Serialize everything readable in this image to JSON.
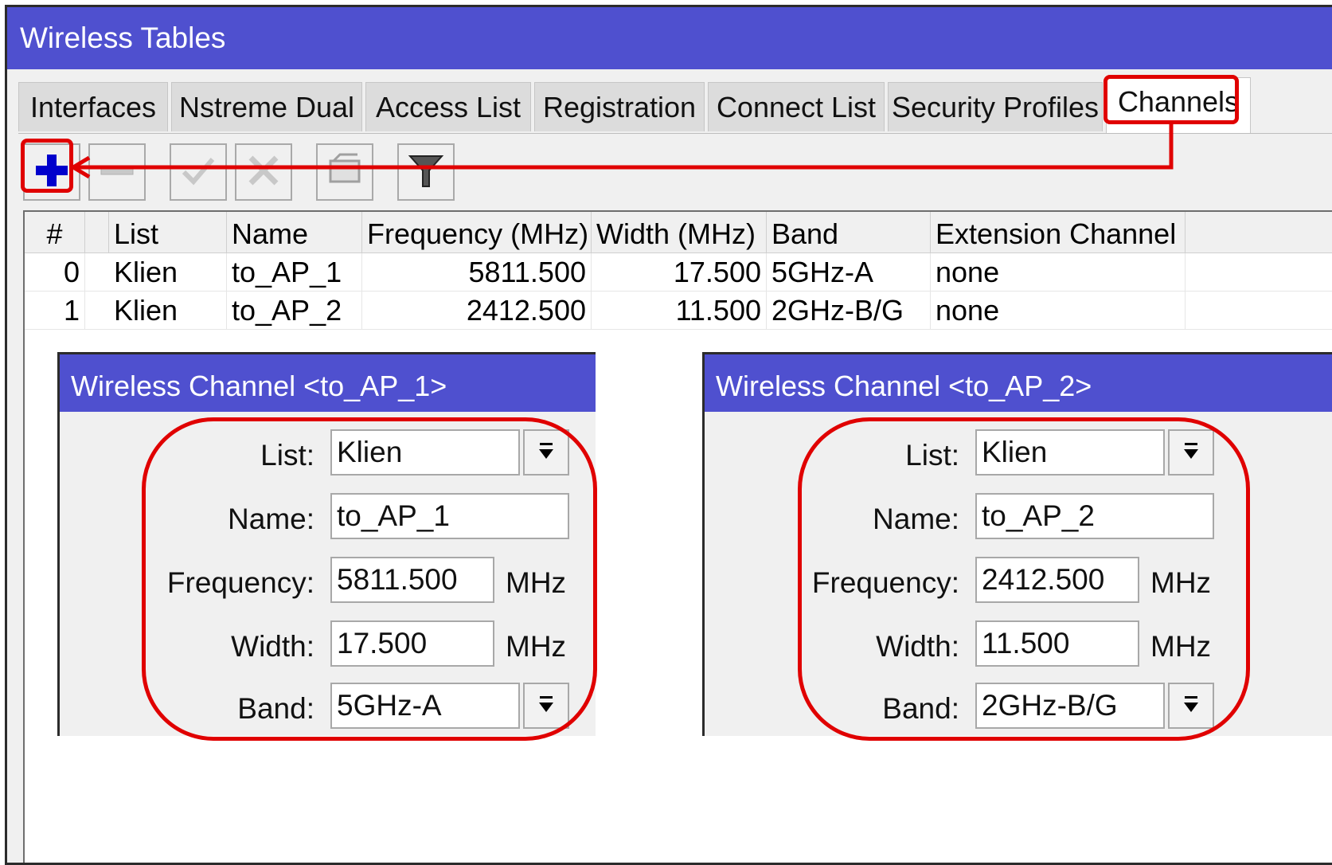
{
  "window": {
    "title": "Wireless Tables"
  },
  "tabs": [
    {
      "label": "Interfaces"
    },
    {
      "label": "Nstreme Dual"
    },
    {
      "label": "Access List"
    },
    {
      "label": "Registration"
    },
    {
      "label": "Connect List"
    },
    {
      "label": "Security Profiles"
    },
    {
      "label": "Channels",
      "active": true
    }
  ],
  "toolbar": {
    "buttons": [
      {
        "name": "add",
        "icon": "plus-icon"
      },
      {
        "name": "remove",
        "icon": "minus-icon"
      },
      {
        "name": "enable",
        "icon": "check-icon"
      },
      {
        "name": "disable",
        "icon": "cross-icon"
      },
      {
        "name": "comment",
        "icon": "comment-icon"
      },
      {
        "name": "filter",
        "icon": "filter-icon"
      }
    ]
  },
  "table": {
    "headers": [
      "#",
      "",
      "List",
      "Name",
      "Frequency (MHz)",
      "Width (MHz)",
      "Band",
      "Extension Channel"
    ],
    "rows": [
      {
        "index": "0",
        "list": "Klien",
        "name": "to_AP_1",
        "frequency": "5811.500",
        "width": "17.500",
        "band": "5GHz-A",
        "extension": "none"
      },
      {
        "index": "1",
        "list": "Klien",
        "name": "to_AP_2",
        "frequency": "2412.500",
        "width": "11.500",
        "band": "2GHz-B/G",
        "extension": "none"
      }
    ]
  },
  "dialogs": [
    {
      "title": "Wireless Channel <to_AP_1>",
      "labels": {
        "list": "List:",
        "name": "Name:",
        "frequency": "Frequency:",
        "width": "Width:",
        "band": "Band:"
      },
      "values": {
        "list": "Klien",
        "name": "to_AP_1",
        "frequency": "5811.500",
        "width": "17.500",
        "band": "5GHz-A"
      },
      "unit": "MHz"
    },
    {
      "title": "Wireless Channel <to_AP_2>",
      "labels": {
        "list": "List:",
        "name": "Name:",
        "frequency": "Frequency:",
        "width": "Width:",
        "band": "Band:"
      },
      "values": {
        "list": "Klien",
        "name": "to_AP_2",
        "frequency": "2412.500",
        "width": "11.500",
        "band": "2GHz-B/G"
      },
      "unit": "MHz"
    }
  ],
  "colors": {
    "titlebar": "#4f50cf",
    "highlight": "#e00000",
    "add_icon": "#0000cc"
  }
}
